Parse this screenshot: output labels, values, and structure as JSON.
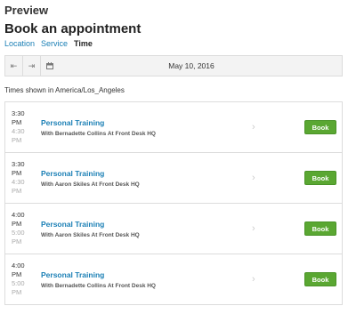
{
  "header": {
    "preview": "Preview",
    "title": "Book an appointment"
  },
  "breadcrumb": {
    "location": "Location",
    "service": "Service",
    "time": "Time"
  },
  "datebar": {
    "date": "May 10, 2016",
    "prev_icon": "arrow-left-icon",
    "next_icon": "arrow-right-icon",
    "calendar_icon": "calendar-icon"
  },
  "timezone": "Times shown in America/Los_Angeles",
  "slots": [
    {
      "start_time": "3:30",
      "start_ampm": "PM",
      "end_time": "4:30",
      "end_ampm": "PM",
      "service": "Personal Training",
      "staff": "With Bernadette Collins At Front Desk HQ",
      "book": "Book"
    },
    {
      "start_time": "3:30",
      "start_ampm": "PM",
      "end_time": "4:30",
      "end_ampm": "PM",
      "service": "Personal Training",
      "staff": "With Aaron Skiles At Front Desk HQ",
      "book": "Book"
    },
    {
      "start_time": "4:00",
      "start_ampm": "PM",
      "end_time": "5:00",
      "end_ampm": "PM",
      "service": "Personal Training",
      "staff": "With Aaron Skiles At Front Desk HQ",
      "book": "Book"
    },
    {
      "start_time": "4:00",
      "start_ampm": "PM",
      "end_time": "5:00",
      "end_ampm": "PM",
      "service": "Personal Training",
      "staff": "With Bernadette Collins At Front Desk HQ",
      "book": "Book"
    }
  ],
  "colors": {
    "link": "#1a7fb5",
    "book_button": "#5aa732"
  }
}
